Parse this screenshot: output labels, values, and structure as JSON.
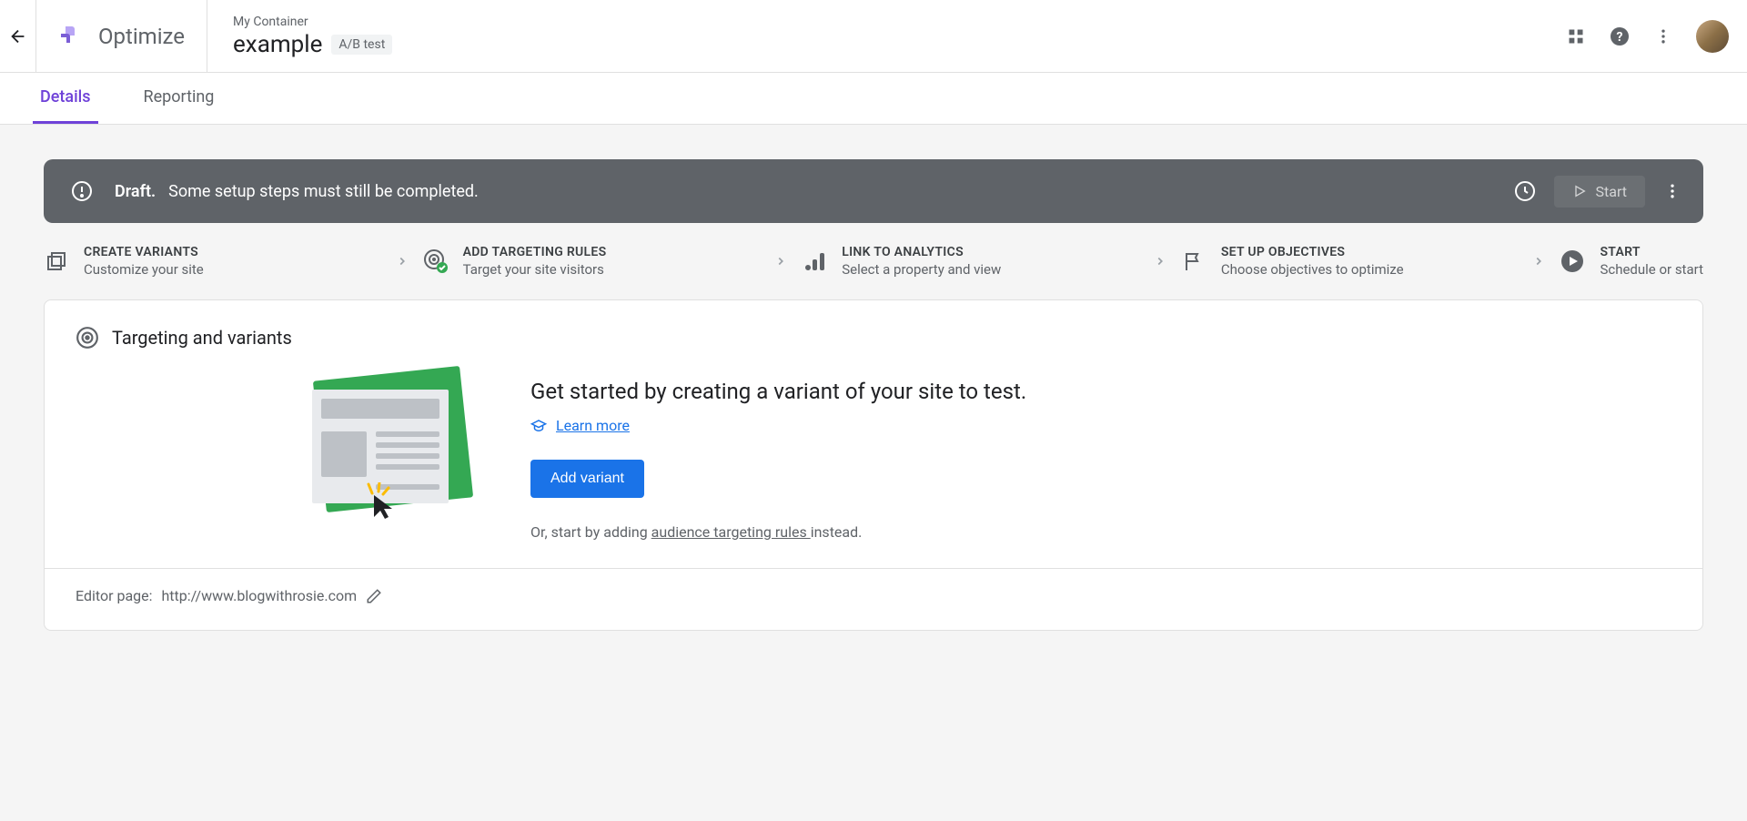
{
  "header": {
    "product_name": "Optimize",
    "container_name": "My Container",
    "experiment_name": "example",
    "test_type": "A/B test"
  },
  "tabs": {
    "details": "Details",
    "reporting": "Reporting"
  },
  "status_bar": {
    "label": "Draft.",
    "message": "Some setup steps must still be completed.",
    "start_label": "Start"
  },
  "steps": [
    {
      "title": "CREATE VARIANTS",
      "subtitle": "Customize your site"
    },
    {
      "title": "ADD TARGETING RULES",
      "subtitle": "Target your site visitors"
    },
    {
      "title": "LINK TO ANALYTICS",
      "subtitle": "Select a property and view"
    },
    {
      "title": "SET UP OBJECTIVES",
      "subtitle": "Choose objectives to optimize"
    },
    {
      "title": "START",
      "subtitle": "Schedule or start"
    }
  ],
  "card": {
    "title": "Targeting and variants",
    "hero": "Get started by creating a variant of your site to test.",
    "learn_more": "Learn more",
    "add_variant": "Add variant",
    "alt_prefix": "Or, start by adding ",
    "alt_link": "audience targeting rules ",
    "alt_suffix": "instead.",
    "editor_label": "Editor page: ",
    "editor_url": "http://www.blogwithrosie.com"
  }
}
